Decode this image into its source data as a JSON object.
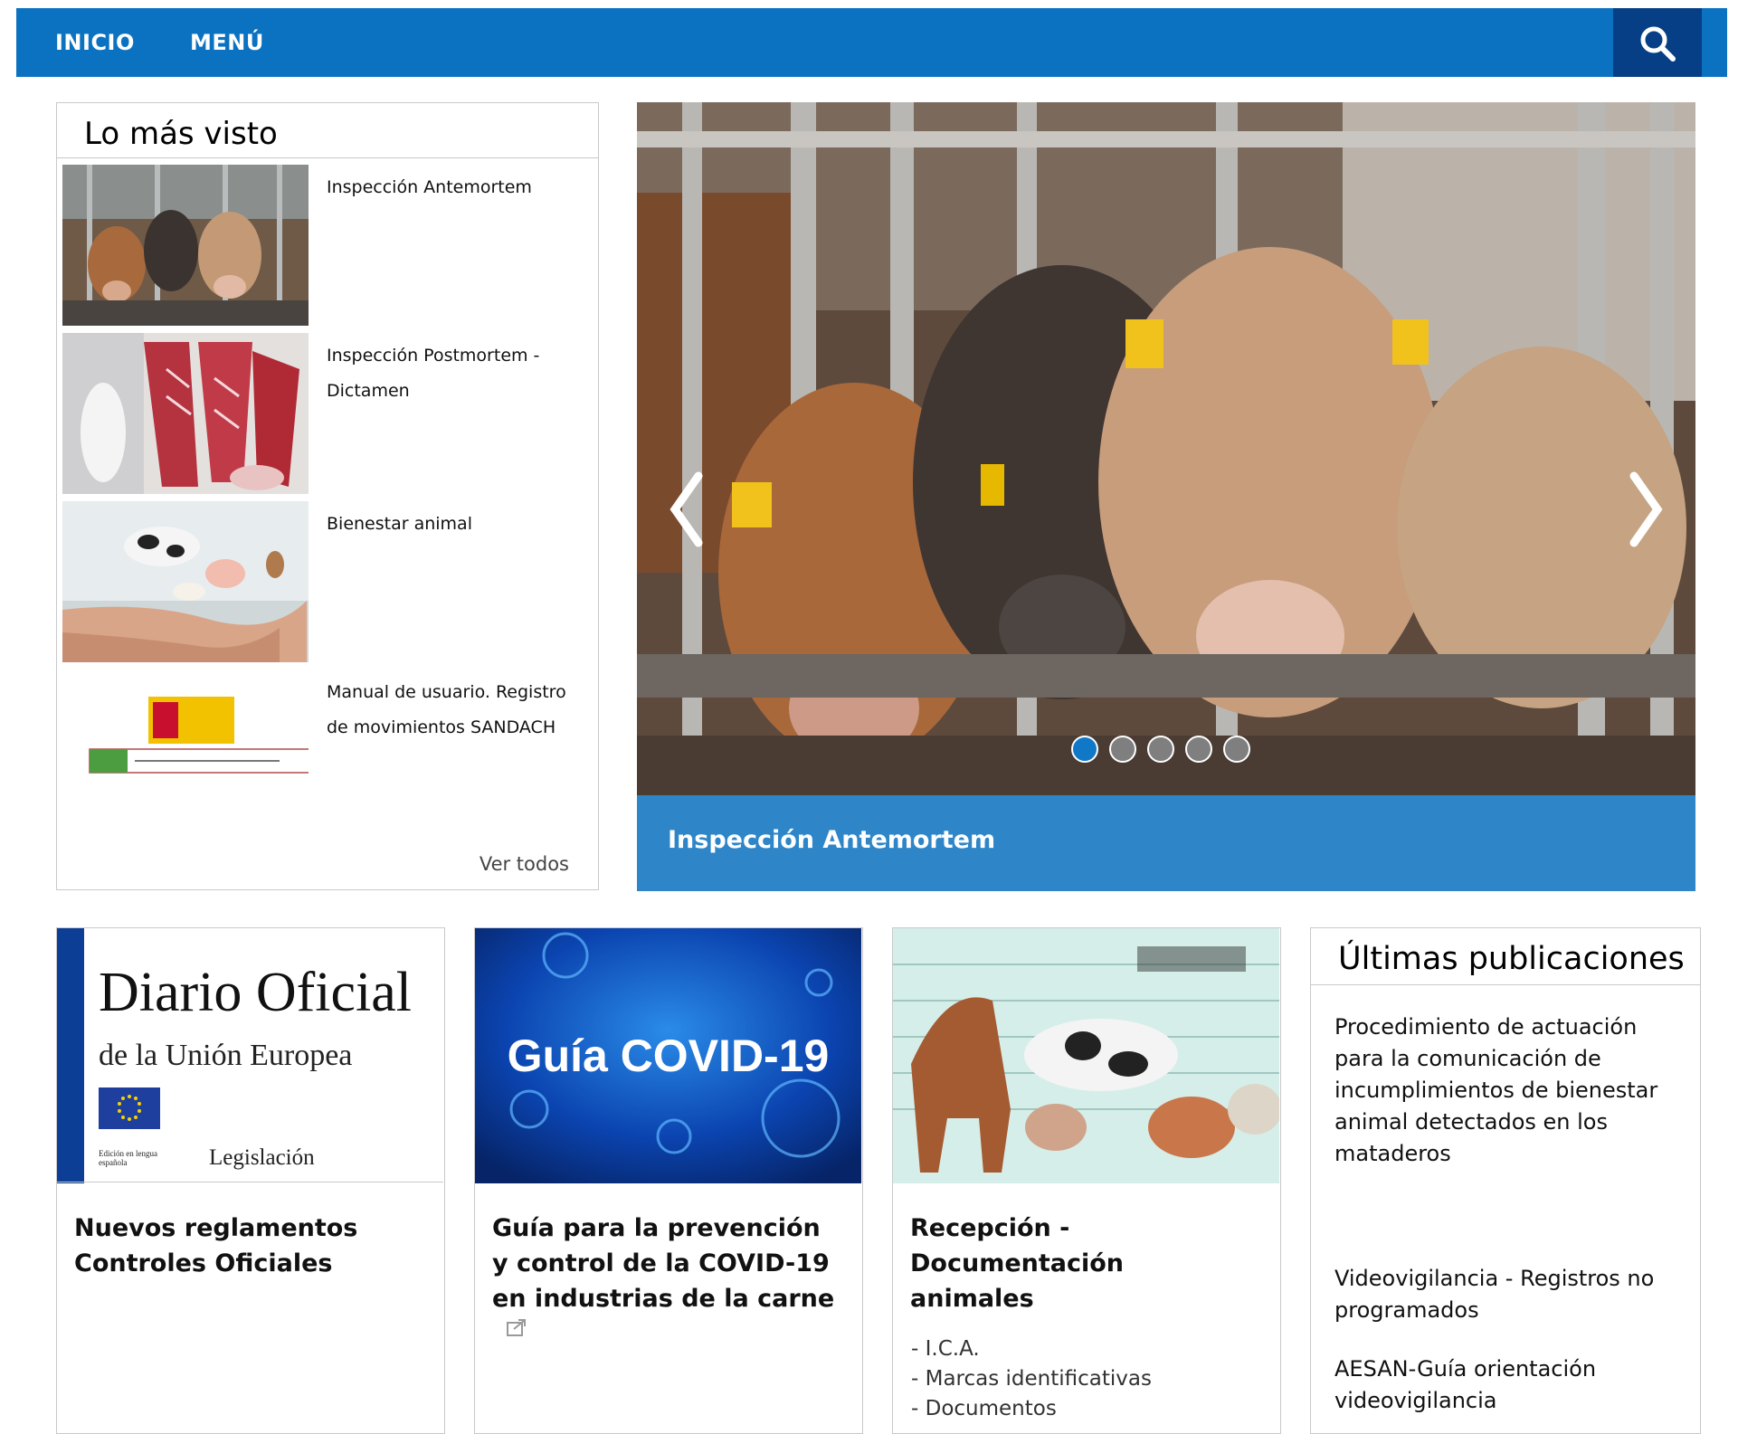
{
  "nav": {
    "home": "INICIO",
    "menu": "MENÚ",
    "search_icon": "search-icon"
  },
  "most_viewed": {
    "title": "Lo más visto",
    "items": [
      {
        "label": "Inspección Antemortem",
        "image": "calves-photo"
      },
      {
        "label": "Inspección Postmortem - Dictamen",
        "image": "carcass-photo"
      },
      {
        "label": "Bienestar animal",
        "image": "animals-in-hands-photo"
      },
      {
        "label": "Manual de usuario. Registro de movimientos SANDACH",
        "image": "sandach-manual-cover"
      }
    ],
    "see_all": "Ver todos"
  },
  "hero": {
    "caption": "Inspección Antemortem",
    "slides": 5,
    "active_slide": 1,
    "prev_icon": "chevron-left-icon",
    "next_icon": "chevron-right-icon"
  },
  "cards": [
    {
      "title": "Nuevos reglamentos Controles Oficiales",
      "image_text": {
        "line1": "Diario Oficial",
        "line2": "de la Unión Europea",
        "small": "Edición en lengua española",
        "legis": "Legislación"
      }
    },
    {
      "title": "Guía para la prevención y control de la COVID-19 en industrias de la carne",
      "image_text": {
        "line1": "Guía COVID-19"
      },
      "share_icon": "share-icon"
    },
    {
      "title": "Recepción - Documentación animales",
      "links": [
        "- I.C.A.",
        "- Marcas identificativas",
        "- Documentos"
      ]
    }
  ],
  "publications": {
    "title": "Últimas publicaciones",
    "items": [
      "Procedimiento de actuación para la comunicación de incumplimientos de bienestar animal detectados en los mataderos",
      "Videovigilancia - Registros no programados",
      "AESAN-Guía orientación videovigilancia"
    ]
  },
  "colors": {
    "nav_blue": "#0b72c1",
    "search_dark_blue": "#063f86",
    "caption_blue": "#2e86c8",
    "active_dot": "#1178c8"
  }
}
